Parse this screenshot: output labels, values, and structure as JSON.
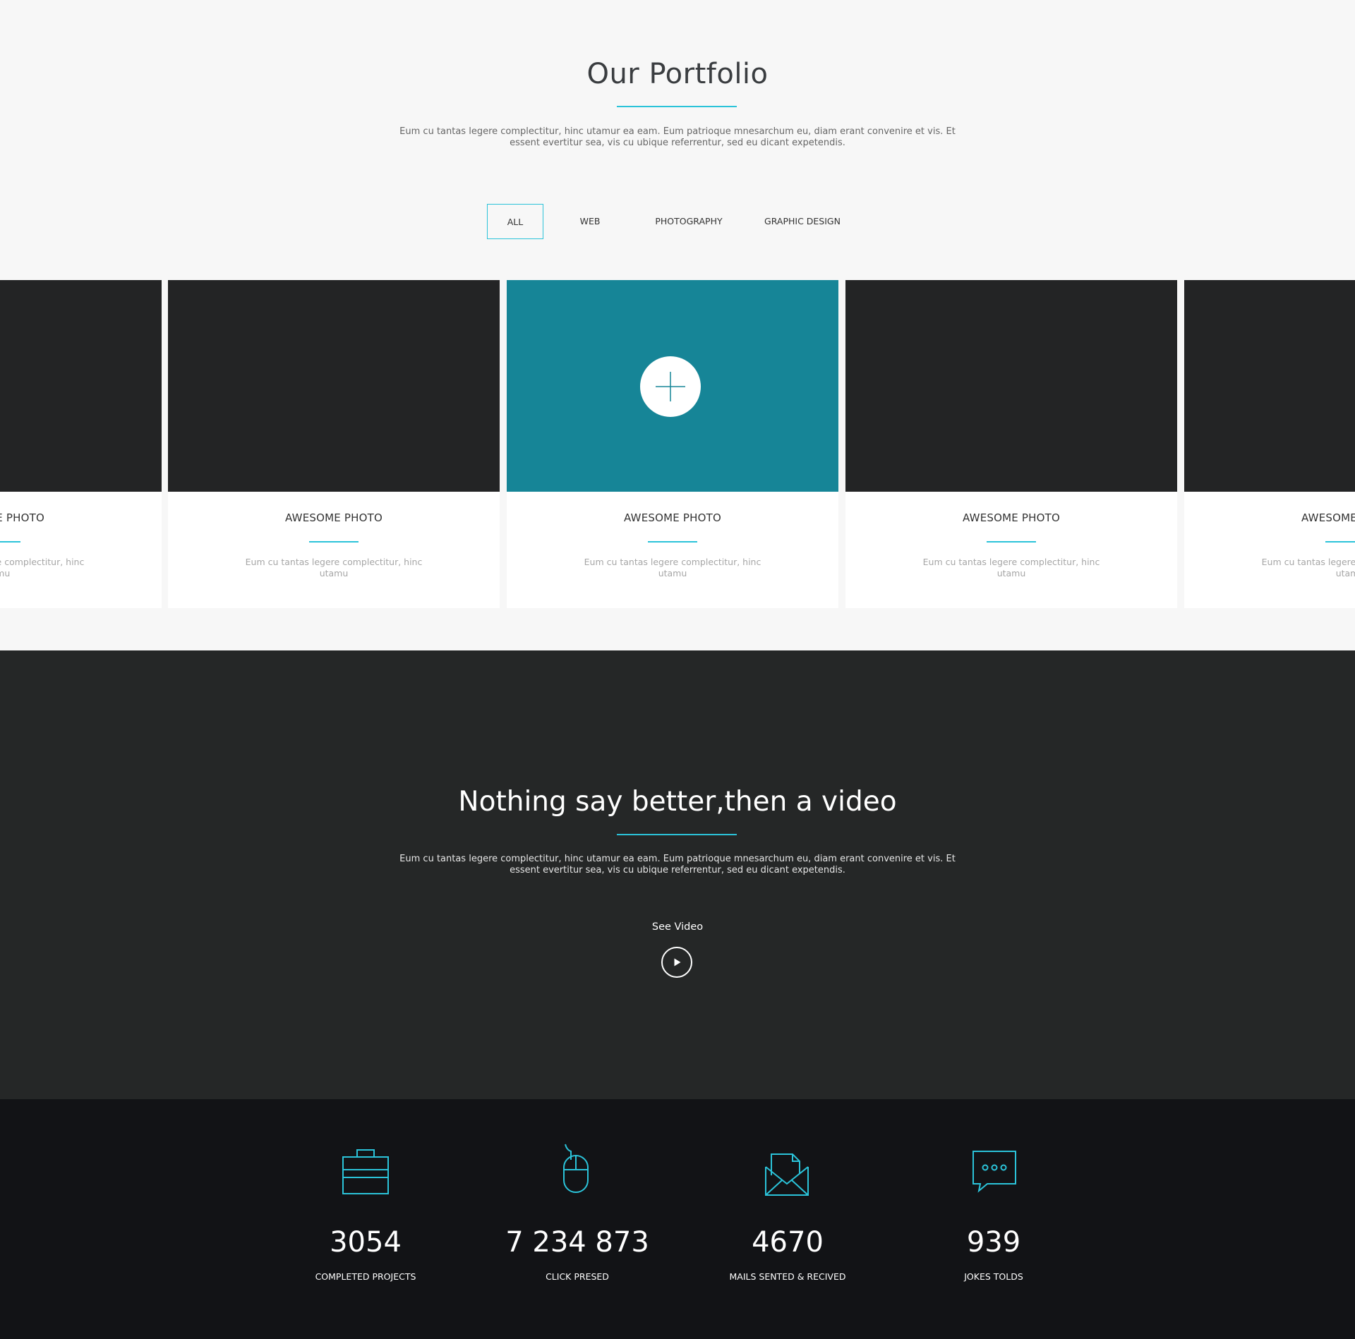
{
  "portfolio": {
    "title": "Our Portfolio",
    "description": "Eum cu tantas legere complectitur, hinc utamur ea eam. Eum patrioque mnesarchum eu, diam erant convenire et vis. Et essent evertitur sea, vis cu ubique referrentur, sed eu dicant expetendis.",
    "filters": [
      "ALL",
      "WEB",
      "PHOTOGRAPHY",
      "GRAPHIC DESIGN"
    ],
    "active_filter": "ALL",
    "cards": [
      {
        "title": "AWESOME PHOTO",
        "description": "Eum cu tantas legere complectitur, hinc utamu"
      },
      {
        "title": "AWESOME PHOTO",
        "description": "Eum cu tantas legere complectitur, hinc utamu"
      },
      {
        "title": "AWESOME PHOTO",
        "description": "Eum cu tantas legere complectitur, hinc utamu"
      },
      {
        "title": "AWESOME PHOTO",
        "description": "Eum cu tantas legere complectitur, hinc utamu"
      },
      {
        "title": "AWESOME PHOTO",
        "description": "Eum cu tantas legere complectitur, hinc utamu"
      }
    ],
    "hover_card_icon": "plus-icon"
  },
  "video": {
    "title": "Nothing say better,then a video",
    "description": "Eum cu tantas legere complectitur, hinc utamur ea eam. Eum patrioque mnesarchum eu, diam erant convenire et vis. Et essent evertitur sea, vis cu ubique referrentur, sed eu dicant expetendis.",
    "cta_label": "See Video",
    "play_icon": "play-icon"
  },
  "stats": [
    {
      "icon": "briefcase-icon",
      "value": "3054",
      "label": "COMPLETED PROJECTS"
    },
    {
      "icon": "mouse-icon",
      "value": "7 234 873",
      "label": "CLICK PRESED"
    },
    {
      "icon": "envelope-icon",
      "value": "4670",
      "label": "MAILS SENTED & RECIVED"
    },
    {
      "icon": "chat-bubble-icon",
      "value": "939",
      "label": "JOKES TOLDS"
    }
  ],
  "colors": {
    "accent": "#2bc3d9",
    "hover_overlay": "#168597",
    "card_image": "#232425",
    "video_bg": "#252727",
    "stats_bg": "#121316",
    "page_bg": "#f7f7f7"
  }
}
